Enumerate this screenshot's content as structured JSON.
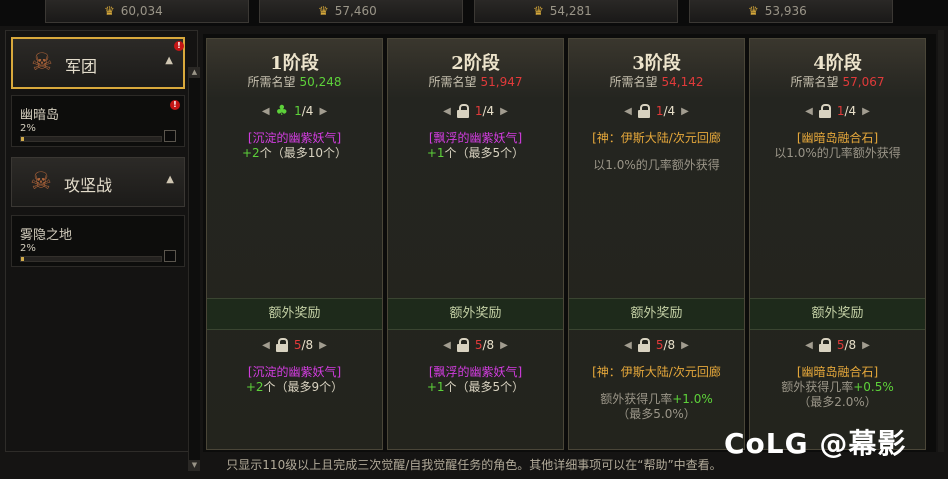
{
  "top": {
    "cards": [
      {
        "value": "60,034"
      },
      {
        "value": "57,460"
      },
      {
        "value": "54,281"
      },
      {
        "value": "53,936"
      }
    ]
  },
  "sidebar": {
    "categories": [
      {
        "label": "军团",
        "active": true,
        "alert": "!"
      },
      {
        "label": "攻坚战",
        "active": false
      }
    ],
    "subs": [
      {
        "name": "幽暗岛",
        "pct": "2%",
        "progress": 0.02,
        "alert": "!"
      },
      {
        "name": "雾隐之地",
        "pct": "2%",
        "progress": 0.02
      }
    ]
  },
  "stages": [
    {
      "title": "1阶段",
      "req_label": "所需名望",
      "req_value": "50,248",
      "req_color": "#5dd13a",
      "nav_icon": "clover-icon",
      "nav_cur": "1",
      "nav_total": "/4",
      "reward_item": "[沉淀的幽紫妖气]",
      "reward_line": "+2个（最多10个）",
      "extra_label": "额外奖励",
      "extra_cur": "5",
      "extra_total": "/8",
      "extra_item": "[沉淀的幽紫妖气]",
      "extra_line": "+2个（最多9个）"
    },
    {
      "title": "2阶段",
      "req_label": "所需名望",
      "req_value": "51,947",
      "req_color": "#e03a3a",
      "nav_icon": "lock-icon",
      "nav_cur": "1",
      "nav_total": "/4",
      "reward_item": "[飘浮的幽紫妖气]",
      "reward_line": "+1个（最多5个）",
      "extra_label": "额外奖励",
      "extra_cur": "5",
      "extra_total": "/8",
      "extra_item": "[飘浮的幽紫妖气]",
      "extra_line": "+1个（最多5个）"
    },
    {
      "title": "3阶段",
      "req_label": "所需名望",
      "req_value": "54,142",
      "req_color": "#e03a3a",
      "nav_icon": "lock-icon",
      "nav_cur": "1",
      "nav_total": "/4",
      "reward_item": "[神：伊斯大陆/次元回廊",
      "reward_line2": "以1.0%的几率额外获得",
      "extra_label": "额外奖励",
      "extra_cur": "5",
      "extra_total": "/8",
      "extra_item": "[神：伊斯大陆/次元回廊",
      "extra_line2a": "额外获得几率",
      "extra_line2b": "+1.0%",
      "extra_line3": "（最多5.0%）"
    },
    {
      "title": "4阶段",
      "req_label": "所需名望",
      "req_value": "57,067",
      "req_color": "#e03a3a",
      "nav_icon": "lock-icon",
      "nav_cur": "1",
      "nav_total": "/4",
      "reward_item": "[幽暗岛融合石]",
      "reward_line2": "以1.0%的几率额外获得",
      "extra_label": "额外奖励",
      "extra_cur": "5",
      "extra_total": "/8",
      "extra_item": "[幽暗岛融合石]",
      "extra_line2a": "额外获得几率",
      "extra_line2b": "+0.5%",
      "extra_line3": "（最多2.0%）"
    }
  ],
  "footer": "只显示110级以上且完成三次觉醒/自我觉醒任务的角色。其他详细事项可以在“帮助”中查看。",
  "watermark": {
    "brand": "CoLG",
    "author": "@幕影"
  }
}
